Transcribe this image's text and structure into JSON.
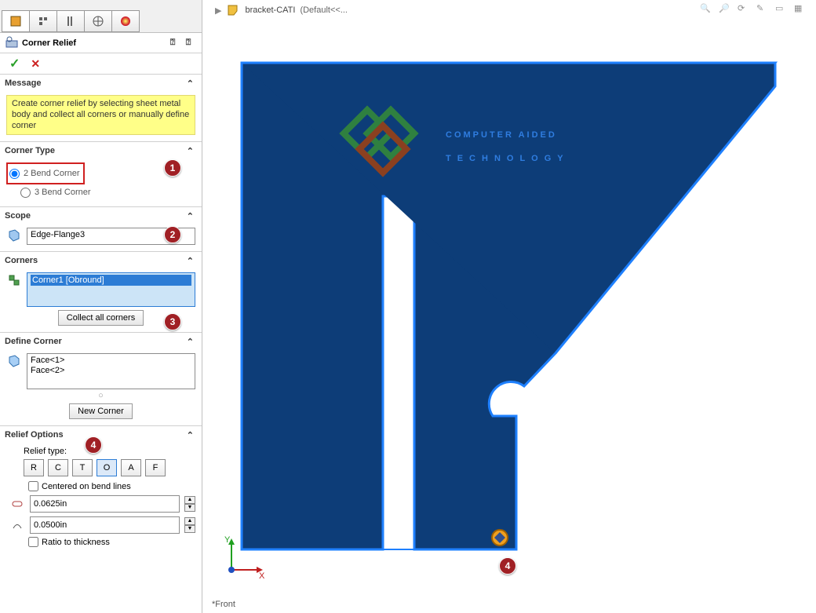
{
  "breadcrumb": {
    "doc": "bracket-CATI",
    "suffix": "(Default<<..."
  },
  "feature": {
    "name": "Corner Relief"
  },
  "message": {
    "title": "Message",
    "text": "Create corner relief by selecting sheet metal body and collect all corners or manually define corner"
  },
  "cornerType": {
    "title": "Corner Type",
    "opt2": "2 Bend Corner",
    "opt3": "3 Bend Corner",
    "selected": "2"
  },
  "scope": {
    "title": "Scope",
    "value": "Edge-Flange3"
  },
  "corners": {
    "title": "Corners",
    "items": [
      "Corner1 [Obround]"
    ],
    "collect_btn": "Collect all corners"
  },
  "defineCorner": {
    "title": "Define Corner",
    "faces": [
      "Face<1>",
      "Face<2>"
    ],
    "new_btn": "New Corner"
  },
  "reliefOptions": {
    "title": "Relief Options",
    "type_label": "Relief type:",
    "icons": [
      "R",
      "C",
      "T",
      "O",
      "A",
      "F"
    ],
    "centered_label": "Centered on bend lines",
    "dim1": "0.0625in",
    "dim2": "0.0500in",
    "ratio_label": "Ratio to thickness"
  },
  "viewport": {
    "view_label": "*Front",
    "logo_line1": "COMPUTER AIDED",
    "logo_line2": "TECHNOLOGY"
  }
}
